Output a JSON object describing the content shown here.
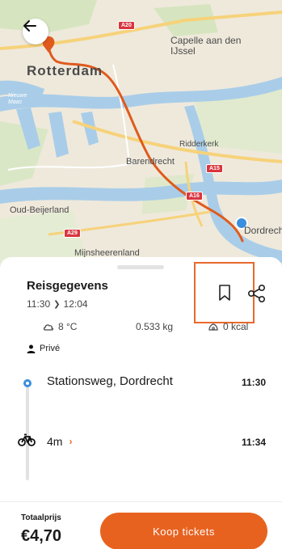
{
  "map": {
    "labels": {
      "rotterdam": "Rotterdam",
      "capelle": "Capelle aan den IJssel",
      "ridderkerk": "Ridderkerk",
      "barendrecht": "Barendrecht",
      "oud_beijerland": "Oud-Beijerland",
      "dordrecht": "Dordrecht",
      "mijnsheerenland": "Mijnsheerenland",
      "nieuwe_maas": "Nieuwe Maas"
    },
    "roads": [
      "A20",
      "A15",
      "A16",
      "A29"
    ],
    "route_color": "#e05a1c",
    "origin_color": "#3b8ede"
  },
  "sheet": {
    "title": "Reisgegevens",
    "depart": "11:30",
    "arrive": "12:04",
    "stats": {
      "temperature": "8 °C",
      "co2": "0.533 kg",
      "kcal": "0 kcal"
    },
    "profile": "Privé"
  },
  "timeline": {
    "stop": {
      "name": "Stationsweg, Dordrecht",
      "time": "11:30"
    },
    "leg": {
      "duration": "4m",
      "time": "11:34"
    }
  },
  "footer": {
    "total_label": "Totaalprijs",
    "total_price": "€4,70",
    "buy_label": "Koop tickets"
  },
  "colors": {
    "accent": "#e8621f",
    "highlight_box": "#e8692b",
    "stop_dot": "#3b8ede"
  }
}
